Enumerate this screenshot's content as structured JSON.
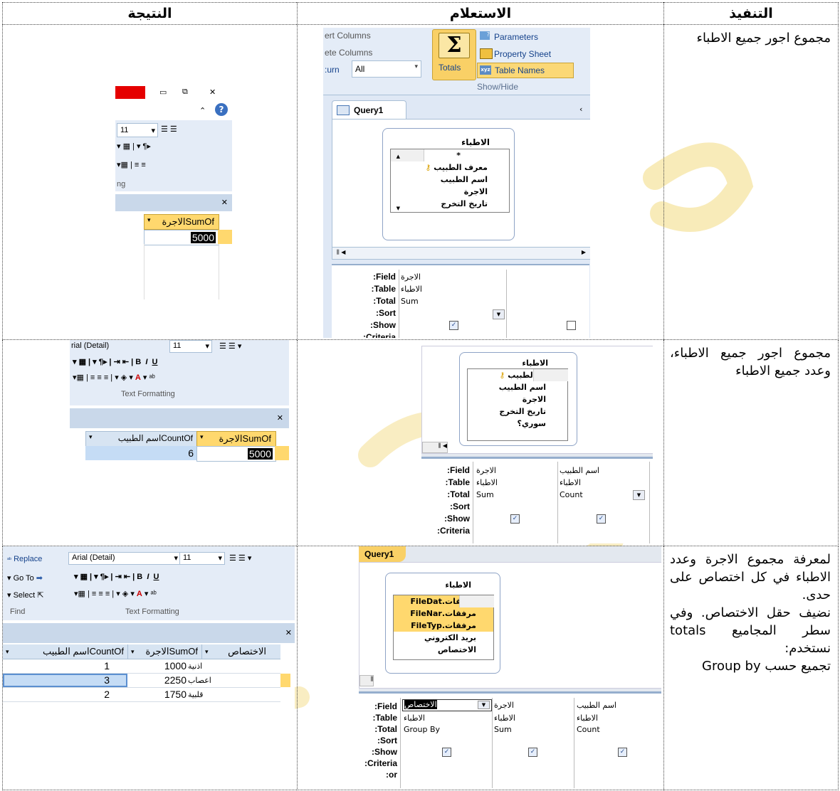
{
  "headers": {
    "execution": "التنفيذ",
    "query": "الاستعلام",
    "result": "النتيجة"
  },
  "rows": [
    {
      "description": "مجموع اجور جميع الاطباء"
    },
    {
      "description": "مجموع اجور جميع الاطباء، وعدد جميع الاطباء"
    },
    {
      "description_lines": [
        "لمعرفة مجموع الاجرة وعدد الاطباء في كل اختصاص على حدى.",
        "نضيف حقل الاختصاص. وفي سطر المجاميع totals نستخدم:",
        "تجميع حسب Group by"
      ]
    }
  ],
  "ribbon1": {
    "insert_columns": "ert Columns",
    "delete_columns": "ete Columns",
    "return_label": "urn:",
    "return_value": "All",
    "totals": "Totals",
    "parameters": "Parameters",
    "property_sheet": "Property Sheet",
    "table_names": "Table Names",
    "group": "Show/Hide",
    "query_tab": "Query1"
  },
  "table_box": {
    "title": "الاطباء",
    "star": "*",
    "fields1": [
      "معرف الطبيب",
      "اسم الطبيب",
      "الاجرة",
      "تاريخ التخرج"
    ],
    "fields2": [
      "معرف الطبيب",
      "اسم الطبيب",
      "الاجرة",
      "تاريخ التخرج",
      "سوري؟"
    ],
    "fields3": [
      "مرفقات.FileDat",
      "مرفقات.FileNar",
      "مرفقات.FileTyp",
      "بريد الكتروني",
      "الاختصاص"
    ]
  },
  "grid_labels": [
    "Field:",
    "Table:",
    "Total:",
    "Sort:",
    "Show:",
    "Criteria:",
    "or:"
  ],
  "grid1": {
    "field": "الاجرة",
    "table": "الاطباء",
    "total": "Sum"
  },
  "grid2": [
    {
      "field": "الاجرة",
      "table": "الاطباء",
      "total": "Sum"
    },
    {
      "field": "اسم الطبيب",
      "table": "الاطباء",
      "total": "Count"
    }
  ],
  "grid3": [
    {
      "field": "الاختصاص",
      "table": "الاطباء",
      "total": "Group By"
    },
    {
      "field": "الاجرة",
      "table": "الاطباء",
      "total": "Sum"
    },
    {
      "field": "اسم الطبيب",
      "table": "الاطباء",
      "total": "Count"
    }
  ],
  "result1": {
    "font_size": "11",
    "group": "ng",
    "col": "SumOfالاجرة",
    "value": "5000"
  },
  "result2": {
    "font": "rial (Detail)",
    "font_size": "11",
    "group": "Text Formatting",
    "col_sum": "SumOfالاجرة",
    "col_count": "CountOfاسم الطبيب",
    "sum": "5000",
    "count": "6"
  },
  "result3": {
    "replace": "Replace",
    "goto": "Go To",
    "select": "Select",
    "find": "Find",
    "font": "Arial (Detail)",
    "font_size": "11",
    "group": "Text Formatting",
    "col_spec": "الاختصاص",
    "col_sum": "SumOfالاجرة",
    "col_count": "CountOfاسم الطبيب",
    "rows": [
      {
        "spec": "اذنية",
        "sum": "1000",
        "count": "1"
      },
      {
        "spec": "اعصاب",
        "sum": "2250",
        "count": "3"
      },
      {
        "spec": "قلبية",
        "sum": "1750",
        "count": "2"
      }
    ]
  },
  "icons": [
    "sigma-icon",
    "close-icon",
    "help-icon",
    "minimize-icon",
    "restore-icon",
    "key-icon",
    "checkbox-icon",
    "dropdown-icon",
    "bold-icon",
    "italic-icon",
    "underline-icon"
  ],
  "colors": {
    "highlight": "#ffd86e",
    "selection": "#c5dcf5",
    "ribbon_button": "#f9d066",
    "watermark": "#f6e6a8"
  }
}
